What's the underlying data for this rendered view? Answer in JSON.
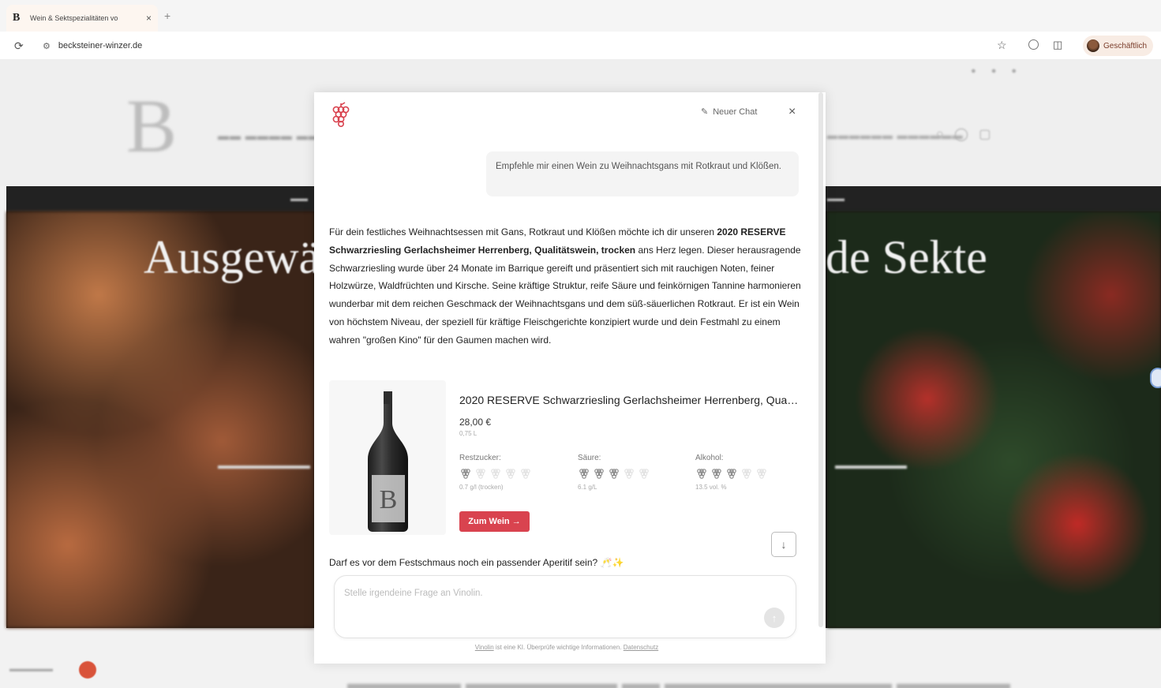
{
  "browser": {
    "tab_title": "Wein & Sektspezialitäten vo",
    "tab_favicon_letter": "B",
    "tab_close": "×",
    "new_tab": "+",
    "url": "becksteiner-winzer.de",
    "profile_label": "Geschäftlich"
  },
  "site": {
    "hero_left_text": "Ausgewä",
    "hero_right_text": "de Sekte"
  },
  "chat": {
    "new_chat_label": "Neuer Chat",
    "close": "×",
    "user_message": "Empfehle mir einen Wein zu Weihnachtsgans mit Rotkraut und Klößen.",
    "bot_paragraph": [
      {
        "t": "Für dein festliches Weihnachtsessen mit Gans, Rotkraut und Klößen möchte ich dir unseren ",
        "b": false
      },
      {
        "t": "2020 RESERVE Schwarzriesling Gerlachsheimer Herrenberg, Qualitätswein, trocken",
        "b": true
      },
      {
        "t": " ans Herz legen. Dieser herausragende Schwarzriesling wurde über 24 Monate im Barrique gereift und präsentiert sich mit rauchigen Noten, feiner Holzwürze, Waldfrüchten und Kirsche. Seine kräftige Struktur, reife Säure und feinkörnigen Tannine harmonieren wunderbar mit dem reichen Geschmack der Weihnachtsgans und dem süß-säuerlichen Rotkraut. Er ist ein Wein von höchstem Niveau, der speziell für kräftige Fleischgerichte konzipiert wurde und dein Festmahl zu einem wahren \"großen Kino\" für den Gaumen machen wird.",
        "b": false
      }
    ],
    "product": {
      "title": "2020 RESERVE Schwarzriesling Gerlachsheimer Herrenberg, Qualitätswein, trocken",
      "price": "28,00 €",
      "volume": "0,75 L",
      "button": "Zum Wein →",
      "attributes": [
        {
          "label": "Restzucker:",
          "level": 1,
          "max": 5,
          "value": "0.7 g/l (trocken)"
        },
        {
          "label": "Säure:",
          "level": 3,
          "max": 5,
          "value": "6.1 g/L"
        },
        {
          "label": "Alkohol:",
          "level": 3,
          "max": 5,
          "value": "13.5 vol. %"
        }
      ]
    },
    "followup": "Darf es vor dem Festschmaus noch ein passender Aperitif sein? 🥂✨",
    "input_placeholder": "Stelle irgendeine Frage an Vinolin.",
    "disclaimer_link": "Vinolin",
    "disclaimer_text": " ist eine KI. Überprüfe wichtige Informationen. ",
    "disclaimer_privacy": "Datenschutz"
  },
  "colors": {
    "accent_red": "#d9434f",
    "grape_red": "#d9434f"
  }
}
